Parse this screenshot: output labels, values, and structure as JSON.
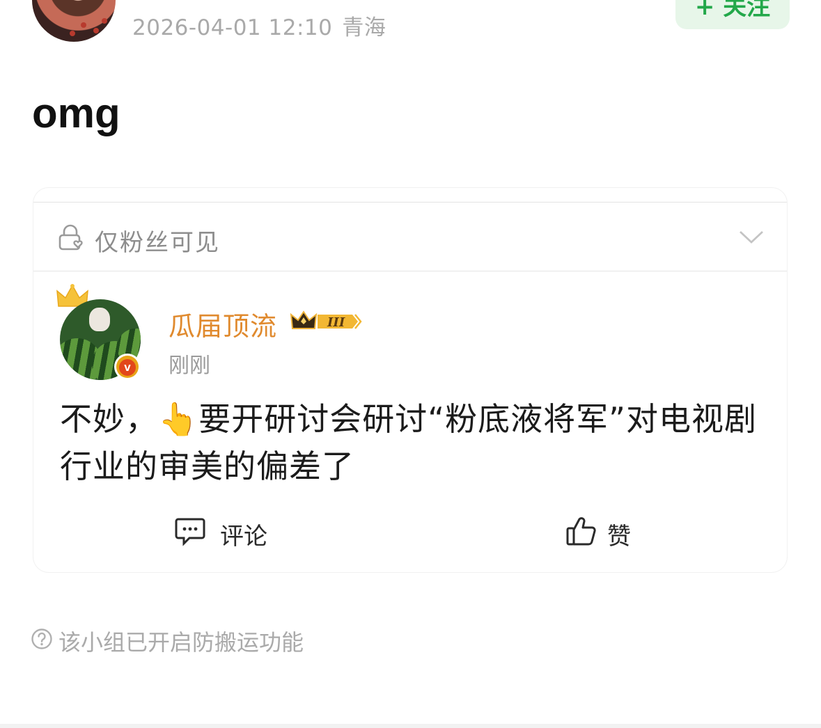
{
  "header": {
    "timestamp": "2026-04-01 12:10",
    "location": "青海",
    "follow_label": "+ 关注"
  },
  "post": {
    "text": "omg"
  },
  "card": {
    "visibility_label": "仅粉丝可见",
    "repost": {
      "author_name": "瓜届顶流",
      "member_level": "III",
      "time": "刚刚",
      "text": "不妙，👆要开研讨会研讨“粉底液将军”对电视剧行业的审美的偏差了"
    },
    "actions": {
      "comment_label": "评论",
      "like_label": "赞"
    }
  },
  "footer": {
    "note": "该小组已开启防搬运功能"
  },
  "colors": {
    "follow_bg": "#e7f6e9",
    "follow_text": "#23a84a",
    "author_name": "#e08a2e",
    "muted_text": "#a9a9a9"
  },
  "icons": [
    "lock-heart-icon",
    "chevron-down-icon",
    "crown-icon",
    "verified-badge-icon",
    "member-crown-badge-icon",
    "comment-icon",
    "thumbs-up-icon",
    "question-circle-icon"
  ]
}
